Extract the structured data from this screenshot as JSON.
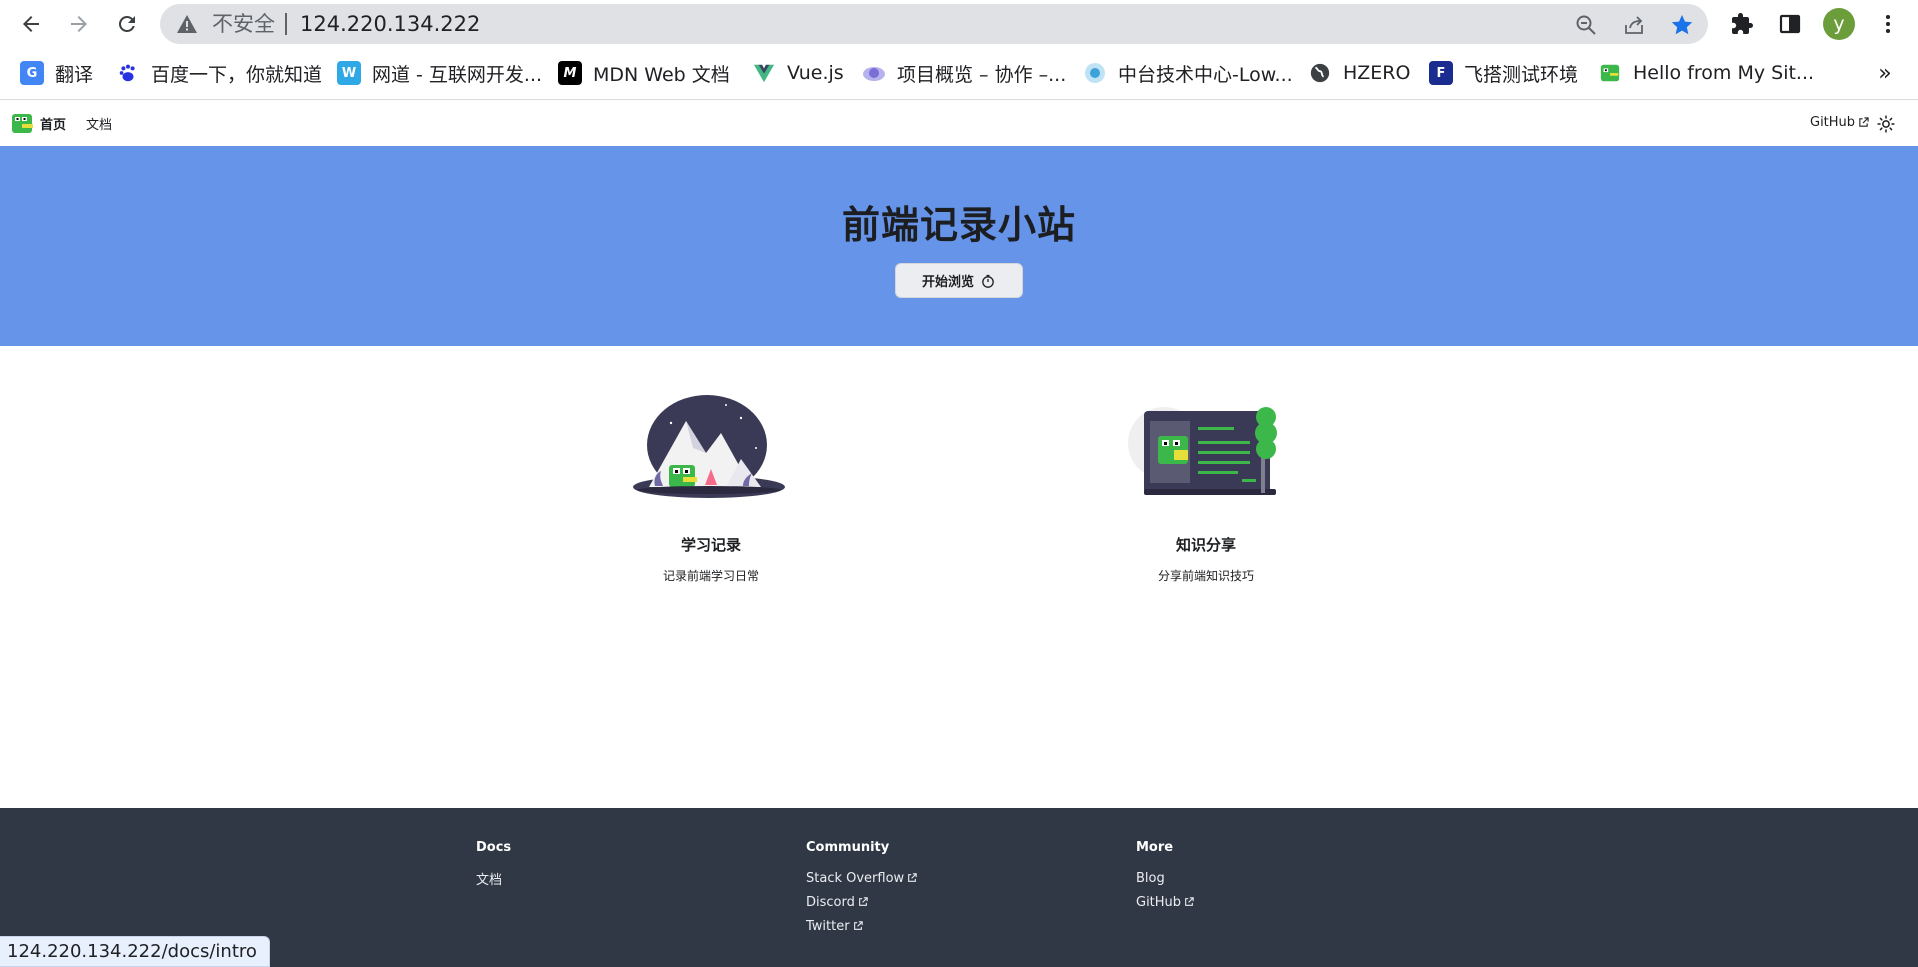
{
  "browser": {
    "security_label": "不安全",
    "url": "124.220.134.222",
    "profile_initial": "y",
    "status_url": "124.220.134.222/docs/intro",
    "bookmarks": [
      {
        "label": "翻译",
        "icon": "google-translate-icon",
        "color": "#4285f4"
      },
      {
        "label": "百度一下，你就知道",
        "icon": "baidu-paw-icon",
        "color": "#2932e1"
      },
      {
        "label": "网道 - 互联网开发...",
        "icon": "wangdoc-icon",
        "color": "#2fa8e6"
      },
      {
        "label": "MDN Web 文档",
        "icon": "mdn-icon",
        "color": "#000000"
      },
      {
        "label": "Vue.js",
        "icon": "vue-icon",
        "color": "#41b883"
      },
      {
        "label": "项目概览 – 协作 –...",
        "icon": "project-icon",
        "color": "#7a6fd6"
      },
      {
        "label": "中台技术中心-Low...",
        "icon": "lowcode-icon",
        "color": "#3ba3d9"
      },
      {
        "label": "HZERO",
        "icon": "globe-icon",
        "color": "#3c4043"
      },
      {
        "label": "飞搭测试环境",
        "icon": "feida-icon",
        "color": "#1a2c8f"
      },
      {
        "label": "Hello from My Sit...",
        "icon": "dino-icon",
        "color": "#3cb84a"
      }
    ]
  },
  "site": {
    "nav": {
      "home": "首页",
      "docs": "文档",
      "github": "GitHub"
    },
    "hero": {
      "title": "前端记录小站",
      "button": "开始浏览"
    },
    "features": [
      {
        "title": "学习记录",
        "desc": "记录前端学习日常"
      },
      {
        "title": "知识分享",
        "desc": "分享前端知识技巧"
      }
    ],
    "footer": {
      "columns": [
        {
          "title": "Docs",
          "links": [
            {
              "label": "文档",
              "external": false
            }
          ]
        },
        {
          "title": "Community",
          "links": [
            {
              "label": "Stack Overflow",
              "external": true
            },
            {
              "label": "Discord",
              "external": true
            },
            {
              "label": "Twitter",
              "external": true
            }
          ]
        },
        {
          "title": "More",
          "links": [
            {
              "label": "Blog",
              "external": false
            },
            {
              "label": "GitHub",
              "external": true
            }
          ]
        }
      ]
    }
  },
  "colors": {
    "hero": "#6594e9",
    "footer": "#303846",
    "accent_green": "#3cb84a"
  }
}
